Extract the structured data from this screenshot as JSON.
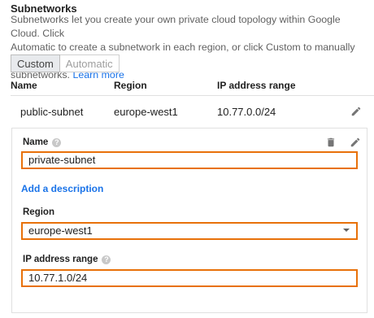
{
  "section": {
    "title": "Subnetworks",
    "description_lines": [
      "Subnetworks let you create your own private cloud topology within Google Cloud. Click",
      "Automatic to create a subnetwork in each region, or click Custom to manually define the",
      "subnetworks."
    ],
    "learn_more": "Learn more"
  },
  "mode_toggle": {
    "custom": "Custom",
    "automatic": "Automatic",
    "selected": "Custom"
  },
  "table": {
    "headers": {
      "name": "Name",
      "region": "Region",
      "ip_range": "IP address range"
    },
    "rows": [
      {
        "name": "public-subnet",
        "region": "europe-west1",
        "ip_range": "10.77.0.0/24"
      }
    ]
  },
  "editor": {
    "name_label": "Name",
    "name_value": "private-subnet",
    "add_description": "Add a description",
    "region_label": "Region",
    "region_value": "europe-west1",
    "ip_label": "IP address range",
    "ip_value": "10.77.1.0/24",
    "help_glyph": "?"
  },
  "icons": {
    "edit": "pencil-icon",
    "delete": "trash-icon",
    "help": "help-icon",
    "dropdown": "caret-down-icon"
  },
  "colors": {
    "accent_link": "#1a73e8",
    "focus_border": "#e8710a"
  }
}
